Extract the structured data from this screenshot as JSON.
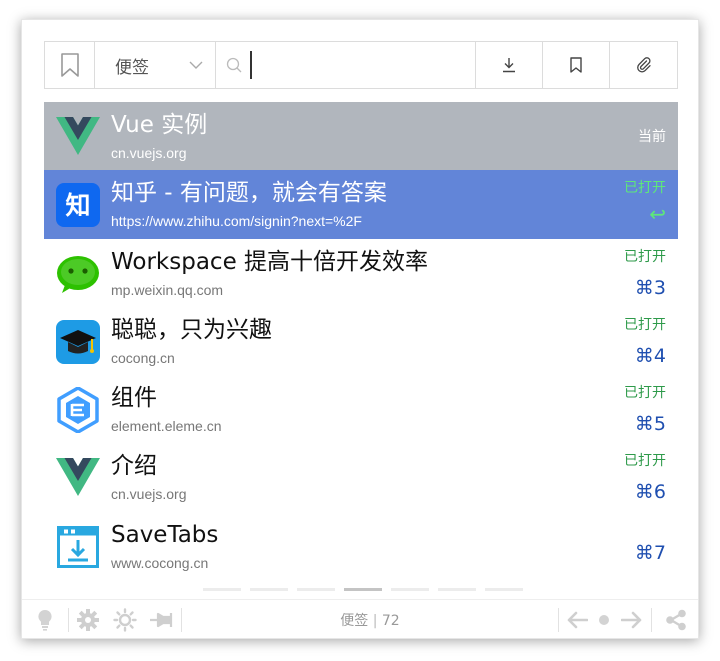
{
  "toolbar": {
    "group_select_value": "便签",
    "search_placeholder": ""
  },
  "tabs": [
    {
      "title": "Vue 实例",
      "url": "cn.vuejs.org",
      "status": "当前",
      "shortcut": "",
      "icon": "vue-logo-icon",
      "state": "current"
    },
    {
      "title": "知乎 - 有问题，就会有答案",
      "url": "https://www.zhihu.com/signin?next=%2F",
      "status": "已打开",
      "shortcut": "↩",
      "icon": "zhihu-logo-icon",
      "state": "selected"
    },
    {
      "title": "Workspace 提高十倍开发效率",
      "url": "mp.weixin.qq.com",
      "status": "已打开",
      "shortcut": "⌘3",
      "icon": "wechat-logo-icon",
      "state": "normal"
    },
    {
      "title": "聪聪，只为兴趣",
      "url": "cocong.cn",
      "status": "已打开",
      "shortcut": "⌘4",
      "icon": "graduation-cap-icon",
      "state": "normal"
    },
    {
      "title": "组件",
      "url": "element.eleme.cn",
      "status": "已打开",
      "shortcut": "⌘5",
      "icon": "element-logo-icon",
      "state": "normal"
    },
    {
      "title": "介绍",
      "url": "cn.vuejs.org",
      "status": "已打开",
      "shortcut": "⌘6",
      "icon": "vue-logo-icon",
      "state": "normal"
    },
    {
      "title": "SaveTabs",
      "url": "www.cocong.cn",
      "status": "",
      "shortcut": "⌘7",
      "icon": "savetabs-logo-icon",
      "state": "normal"
    }
  ],
  "pager": {
    "pages": 7,
    "active": 3
  },
  "footer": {
    "group_name": "便签",
    "separator": " | ",
    "count": "72"
  },
  "colors": {
    "current_row": "#b1b6bd",
    "selected_row": "#6285d8",
    "status_green": "#2e9a4a",
    "shortcut_blue": "#1f4fb0"
  }
}
